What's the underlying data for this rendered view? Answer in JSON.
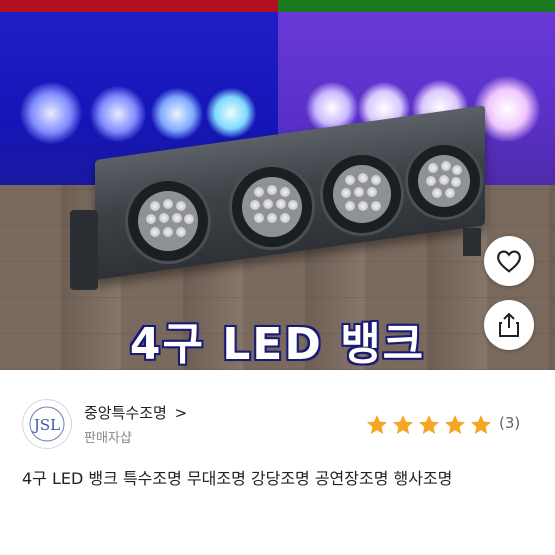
{
  "hero": {
    "overlay_text": "4구 LED 뱅크",
    "like_icon": "heart-outline-icon",
    "share_icon": "share-icon"
  },
  "seller": {
    "logo_text": "JSL",
    "name": "중앙특수조명",
    "chevron": ">",
    "type": "판매자샵",
    "rating_stars": 5,
    "review_count": "(3)",
    "star_color": "#f5a623"
  },
  "product": {
    "title": "4구 LED 뱅크 특수조명 무대조명 강당조명 공연장조명 행사조명"
  },
  "colors": {
    "bg_blue": "#1a1ac0",
    "bg_purple": "#5a30c8"
  }
}
